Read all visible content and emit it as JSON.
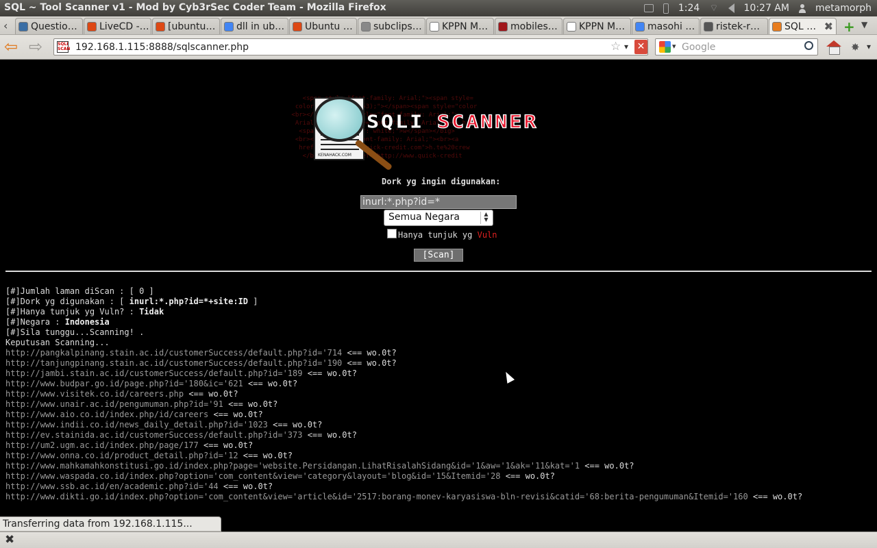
{
  "window": {
    "title": "SQL ~ Tool Scanner v1 - Mod by Cyb3rSec Coder Team - Mozilla Firefox",
    "tray": {
      "battery": "1:24",
      "clock": "10:27 AM",
      "user": "metamorph"
    }
  },
  "tabs": [
    {
      "label": "Questio…",
      "icon_color": "#3a6ea5"
    },
    {
      "label": "LiveCD -…",
      "icon_color": "#dd4814"
    },
    {
      "label": "[ubuntu…",
      "icon_color": "#dd4814"
    },
    {
      "label": "dll in ub…",
      "icon_color": "#4285f4"
    },
    {
      "label": "Ubuntu …",
      "icon_color": "#dd4814"
    },
    {
      "label": "subclips…",
      "icon_color": "#888888"
    },
    {
      "label": "KPPN M…",
      "icon_color": "#ffffff"
    },
    {
      "label": "mobiles…",
      "icon_color": "#a0161a"
    },
    {
      "label": "KPPN M…",
      "icon_color": "#ffffff"
    },
    {
      "label": "masohi …",
      "icon_color": "#4285f4"
    },
    {
      "label": "ristek-r…",
      "icon_color": "#555555"
    },
    {
      "label": "SQL …",
      "icon_color": "#e87d1e"
    }
  ],
  "nav": {
    "url": "192.168.1.115:8888/sqlscanner.php",
    "favicon_text": "SQLI SCAN",
    "search_placeholder": "Google"
  },
  "page": {
    "logo_text": {
      "sqli": "SQLI",
      "scanner": "SCANNER",
      "caption": "KENAHACK.COM"
    },
    "form": {
      "dork_label": "Dork yg ingin digunakan:",
      "dork_value": "inurl:*.php?id=*",
      "country_selected": "Semua Negara",
      "vuln_label": "Hanya tunjuk yg ",
      "vuln_word": "Vuln",
      "scan_button": "[Scan]"
    },
    "summary": {
      "pages_line": "[#]Jumlah laman diScan : [ 0 ]",
      "dork_prefix": "[#]Dork yg digunakan : [ ",
      "dork_value": "inurl:*.php?id=*+site:ID",
      "dork_suffix": " ]",
      "vuln_prefix": "[#]Hanya tunjuk yg Vuln? : ",
      "vuln_value": "Tidak",
      "country_prefix": "[#]Negara : ",
      "country_value": "Indonesia",
      "wait_line": "[#]Sila tunggu...Scanning! .",
      "result_heading": "Keputusan Scanning..."
    },
    "result_marker": " <== wo.0t?",
    "results": [
      "http://pangkalpinang.stain.ac.id/customerSuccess/default.php?id='714",
      "http://tanjungpinang.stain.ac.id/customerSuccess/default.php?id='190",
      "http://jambi.stain.ac.id/customerSuccess/default.php?id='189",
      "http://www.budpar.go.id/page.php?id='180&ic='621",
      "http://www.visitek.co.id/careers.php",
      "http://www.unair.ac.id/pengumuman.php?id='91",
      "http://www.aio.co.id/index.php/id/careers",
      "http://www.indii.co.id/news_daily_detail.php?id='1023",
      "http://ev.stainida.ac.id/customerSuccess/default.php?id='373",
      "http://um2.ugm.ac.id/index.php/page/177",
      "http://www.onna.co.id/product_detail.php?id='12",
      "http://www.mahkamahkonstitusi.go.id/index.php?page='website.Persidangan.LihatRisalahSidang&id='1&aw='1&ak='11&kat='1",
      "http://www.waspada.co.id/index.php?option='com_content&view='category&layout='blog&id='15&Itemid='28",
      "http://www.ssb.ac.id/en/academic.php?id='44",
      "http://www.dikti.go.id/index.php?option='com_content&view='article&id='2517:borang-monev-karyasiswa-bln-revisi&catid='68:berita-pengumuman&Itemid='160"
    ]
  },
  "status": {
    "text": "Transferring data from 192.168.1.115..."
  }
}
